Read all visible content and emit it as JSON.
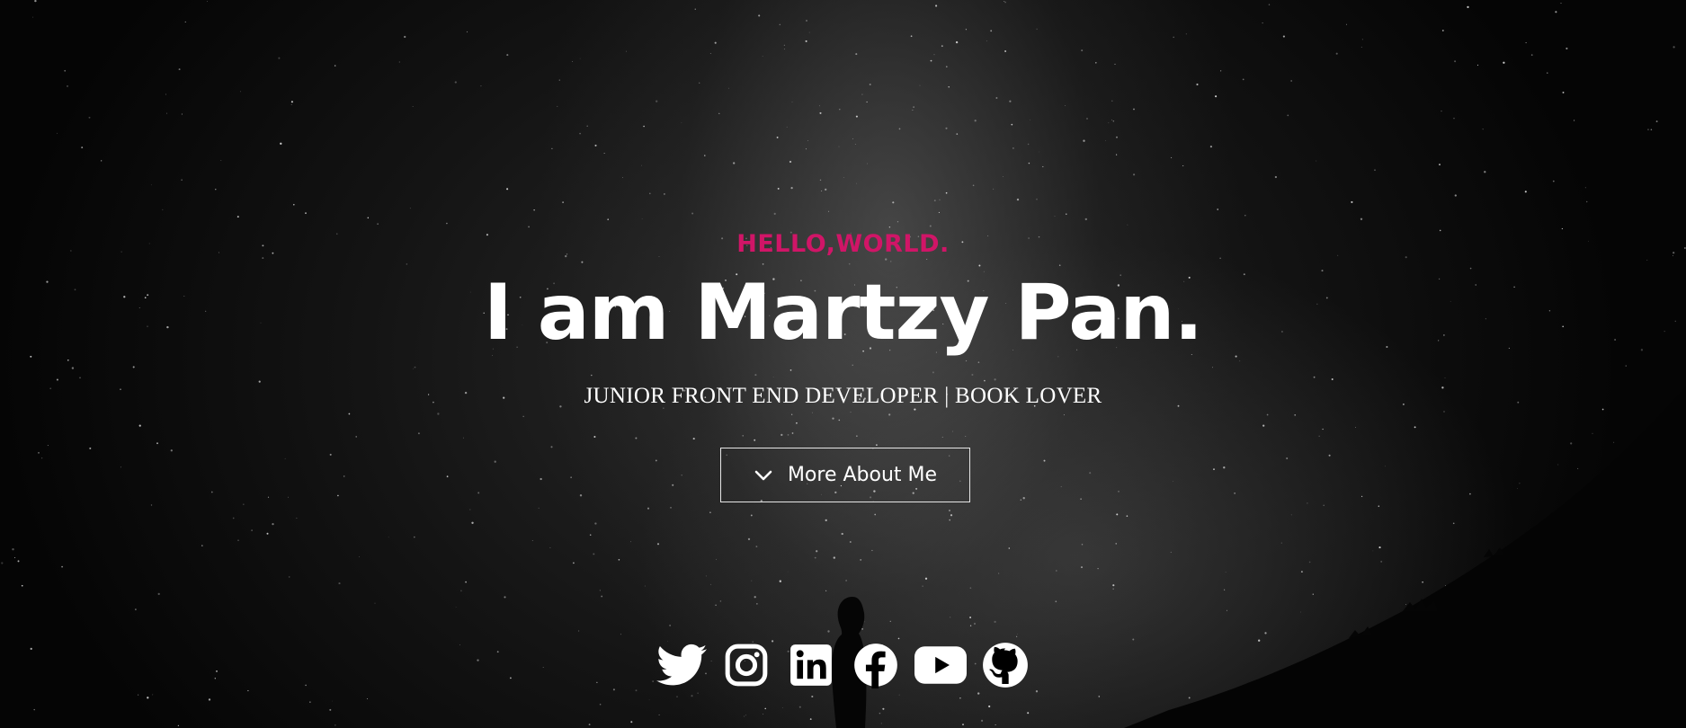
{
  "hero": {
    "greeting": "HELLO,WORLD.",
    "headline": "I am Martzy Pan.",
    "subtitle": "JUNIOR FRONT END DEVELOPER | BOOK LOVER",
    "cta_label": "More About Me",
    "cta_icon": "chevron-down-icon"
  },
  "social_links": [
    {
      "icon": "twitter-icon"
    },
    {
      "icon": "instagram-icon"
    },
    {
      "icon": "linkedin-icon"
    },
    {
      "icon": "facebook-icon"
    },
    {
      "icon": "youtube-icon"
    },
    {
      "icon": "github-icon"
    }
  ],
  "colors": {
    "accent": "#d01567",
    "text": "#ffffff",
    "background": "#000000"
  }
}
